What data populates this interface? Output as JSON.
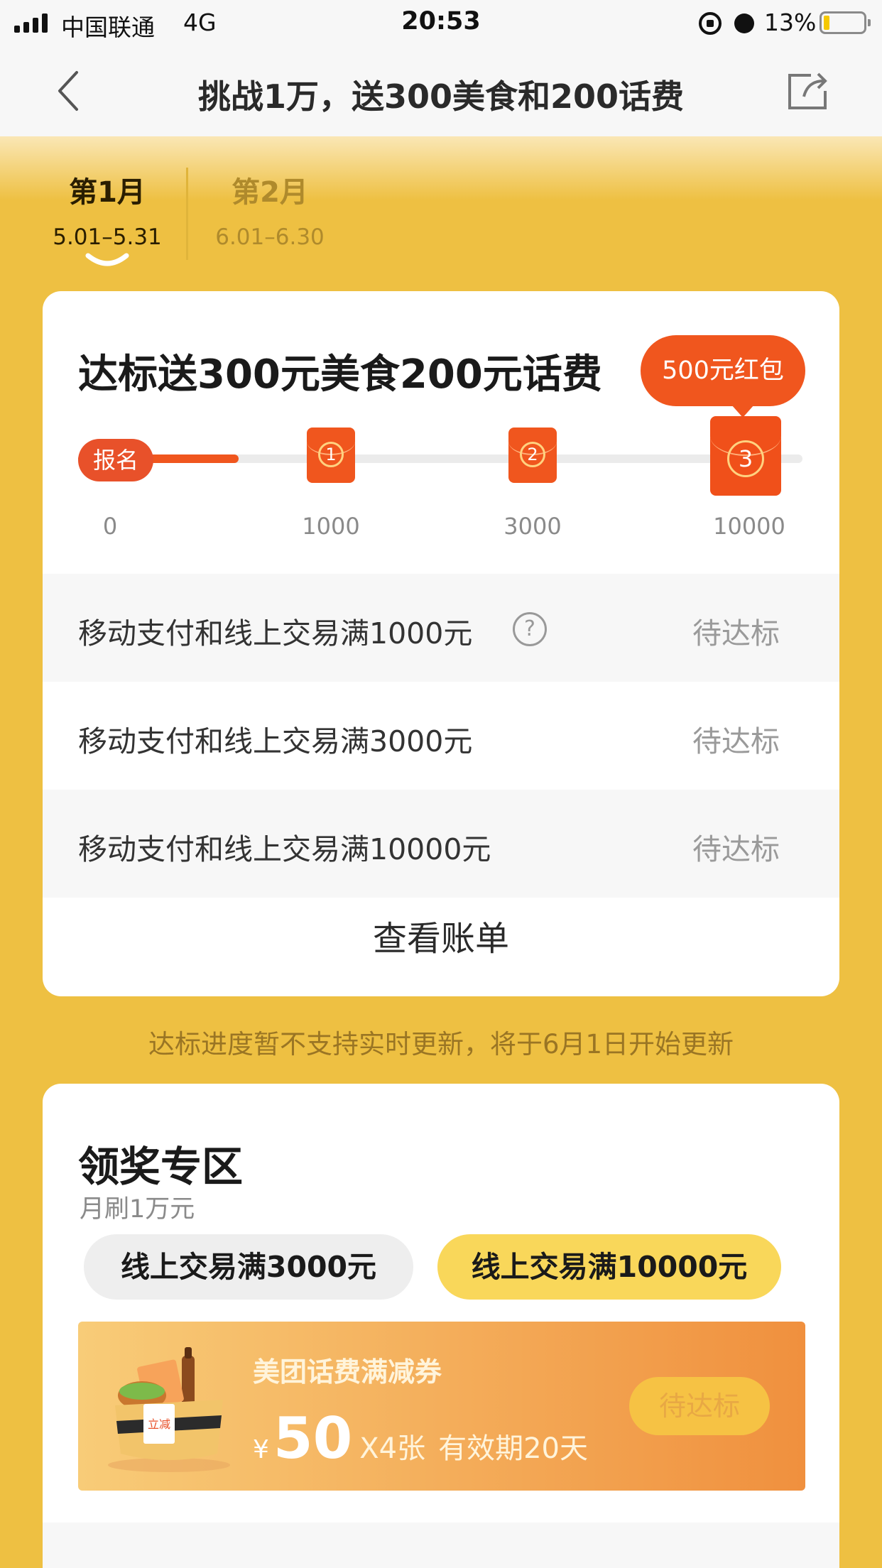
{
  "status_bar": {
    "carrier": "中国联通",
    "network": "4G",
    "time": "20:53",
    "battery_percent": "13%",
    "icons": [
      "signal-icon",
      "orientation-lock-icon",
      "alarm-icon",
      "battery-icon"
    ]
  },
  "nav": {
    "title": "挑战1万，送300美食和200话费",
    "icons": [
      "chevron-left-icon",
      "share-icon"
    ]
  },
  "month_tabs": [
    {
      "name": "第1月",
      "range": "5.01–5.31",
      "selected": true
    },
    {
      "name": "第2月",
      "range": "6.01–6.30",
      "selected": false
    }
  ],
  "progress_card": {
    "heading": "达标送300元美食200元话费",
    "bubble": "500元红包",
    "signup_label": "报名",
    "milestone_badges": [
      "1",
      "2",
      "3"
    ],
    "ticks": [
      "0",
      "1000",
      "3000",
      "10000"
    ],
    "progress_fraction": 0.0,
    "tasks": [
      {
        "label": "移动支付和线上交易满1000元",
        "status": "待达标",
        "help": "?"
      },
      {
        "label": "移动支付和线上交易满3000元",
        "status": "待达标"
      },
      {
        "label": "移动支付和线上交易满10000元",
        "status": "待达标"
      }
    ],
    "view_bill": "查看账单"
  },
  "notice": "达标进度暂不支持实时更新，将于6月1日开始更新",
  "reward_section": {
    "title": "领奖专区",
    "subtitle": "月刷1万元",
    "chips": [
      {
        "label": "线上交易满3000元",
        "selected": false
      },
      {
        "label": "线上交易满10000元",
        "selected": true
      }
    ],
    "coupon": {
      "title": "美团话费满减券",
      "currency": "¥",
      "amount": "50",
      "quantity": "X4张",
      "validity": "有效期20天",
      "button": "待达标",
      "stamp": "立减"
    }
  },
  "colors": {
    "page_bg": "#EEC042",
    "accent": "#F0561E",
    "chip_selected": "#F9D75A"
  }
}
